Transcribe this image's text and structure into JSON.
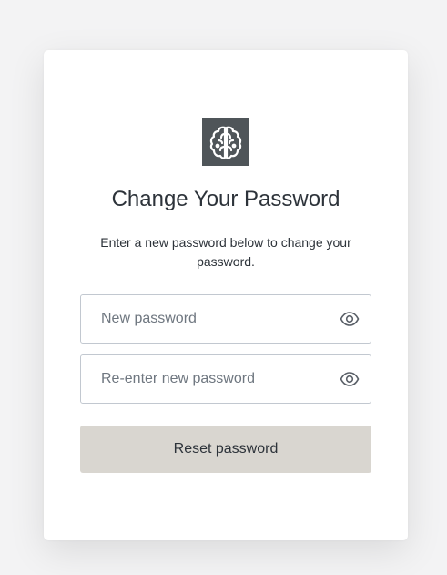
{
  "header": {
    "logo_icon": "brain-icon",
    "title": "Change Your Password",
    "description": "Enter a new password below to change your password."
  },
  "form": {
    "new_password": {
      "placeholder": "New password",
      "value": "",
      "toggle_icon": "eye-icon"
    },
    "confirm_password": {
      "placeholder": "Re-enter new password",
      "value": "",
      "toggle_icon": "eye-icon"
    },
    "submit_label": "Reset password"
  },
  "colors": {
    "logo_background": "#4f5559",
    "button_background": "#d9d6d0",
    "text": "#2d333a",
    "field_border": "#c2c8d0"
  }
}
